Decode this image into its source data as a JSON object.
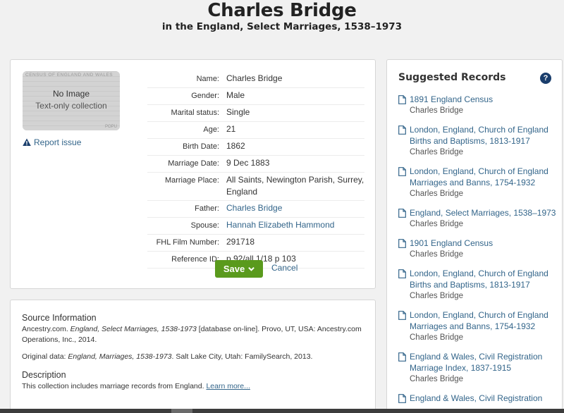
{
  "header": {
    "title": "Charles Bridge",
    "subtitle": "in the England, Select Marriages, 1538–1973"
  },
  "record": {
    "thumbnail": {
      "title": "No Image",
      "subtitle": "Text-only collection",
      "bg_header": "CENSUS OF ENGLAND AND WALES",
      "bg_footer": "POPU"
    },
    "report_label": "Report issue",
    "fields": [
      {
        "label": "Name:",
        "value": "Charles Bridge",
        "link": false
      },
      {
        "label": "Gender:",
        "value": "Male",
        "link": false
      },
      {
        "label": "Marital status:",
        "value": "Single",
        "link": false
      },
      {
        "label": "Age:",
        "value": "21",
        "link": false
      },
      {
        "label": "Birth Date:",
        "value": "1862",
        "link": false
      },
      {
        "label": "Marriage Date:",
        "value": "9 Dec 1883",
        "link": false
      },
      {
        "label": "Marriage Place:",
        "value": "All Saints, Newington Parish, Surrey, England",
        "link": false
      },
      {
        "label": "Father:",
        "value": "Charles Bridge",
        "link": true
      },
      {
        "label": "Spouse:",
        "value": "Hannah Elizabeth Hammond",
        "link": true
      },
      {
        "label": "FHL Film Number:",
        "value": "291718",
        "link": false
      },
      {
        "label": "Reference ID:",
        "value": "p 92/all 1/18 p 103",
        "link": false
      }
    ],
    "save_label": "Save",
    "cancel_label": "Cancel"
  },
  "source": {
    "heading": "Source Information",
    "citation_pre": "Ancestry.com. ",
    "citation_title": "England, Select Marriages, 1538-1973",
    "citation_post": " [database on-line]. Provo, UT, USA: Ancestry.com Operations, Inc., 2014.",
    "original_pre": "Original data: ",
    "original_title": "England, Marriages, 1538-1973",
    "original_post": ". Salt Lake City, Utah: FamilySearch, 2013.",
    "description_heading": "Description",
    "description_text": "This collection includes marriage records from England. ",
    "learn_more": "Learn more..."
  },
  "suggested": {
    "title": "Suggested Records",
    "help_glyph": "?",
    "items": [
      {
        "title": "1891 England Census",
        "person": "Charles Bridge"
      },
      {
        "title": "London, England, Church of England Births and Baptisms, 1813-1917",
        "person": "Charles Bridge"
      },
      {
        "title": "London, England, Church of England Marriages and Banns, 1754-1932",
        "person": "Charles Bridge"
      },
      {
        "title": "England, Select Marriages, 1538–1973",
        "person": "Charles Bridge"
      },
      {
        "title": "1901 England Census",
        "person": "Charles Bridge"
      },
      {
        "title": "London, England, Church of England Births and Baptisms, 1813-1917",
        "person": "Charles Bridge"
      },
      {
        "title": "London, England, Church of England Marriages and Banns, 1754-1932",
        "person": "Charles Bridge"
      },
      {
        "title": "England & Wales, Civil Registration Marriage Index, 1837-1915",
        "person": "Charles Bridge"
      },
      {
        "title": "England & Wales, Civil Registration",
        "person": ""
      }
    ]
  },
  "colors": {
    "link": "#33658a",
    "save_button": "#5a9a1d",
    "help_icon": "#1a3e6c",
    "page_bg": "#f1f1f1"
  }
}
